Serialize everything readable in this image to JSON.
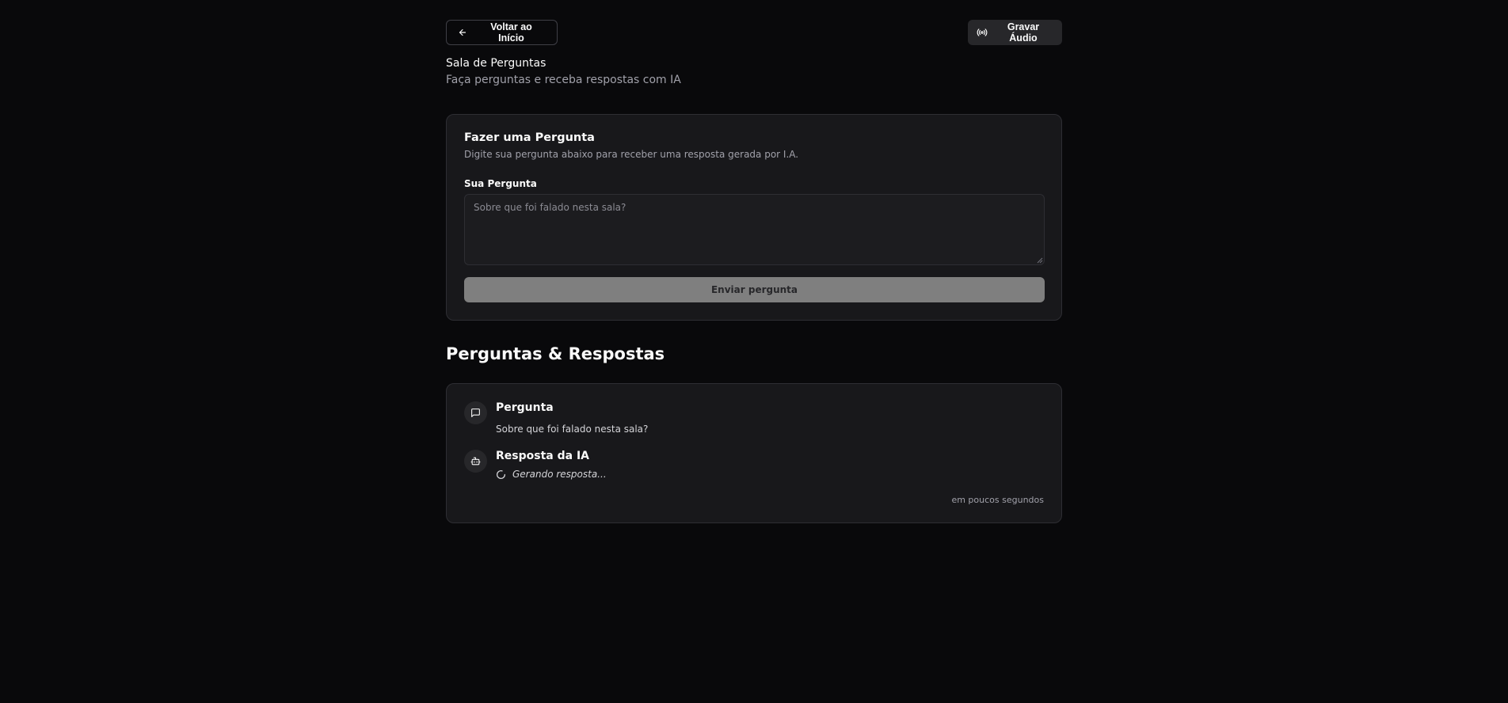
{
  "header": {
    "back_label": "Voltar ao Início",
    "record_label": "Gravar Áudio",
    "room_title": "Sala de Perguntas",
    "room_subtitle": "Faça perguntas e receba respostas com IA"
  },
  "ask_form": {
    "title": "Fazer uma Pergunta",
    "description": "Digite sua pergunta abaixo para receber uma resposta gerada por I.A.",
    "field_label": "Sua Pergunta",
    "placeholder": "Sobre que foi falado nesta sala?",
    "value": "",
    "submit_label": "Enviar pergunta"
  },
  "qa_section": {
    "title": "Perguntas & Respostas",
    "items": [
      {
        "question_label": "Pergunta",
        "question_text": "Sobre que foi falado nesta sala?",
        "answer_label": "Resposta da IA",
        "answer_status": "Gerando resposta...",
        "timestamp": "em poucos segundos"
      }
    ]
  },
  "icons": {
    "back": "arrow-left-icon",
    "record": "radio-icon",
    "question": "message-square-icon",
    "answer": "bot-icon",
    "loading": "loader-icon"
  },
  "colors": {
    "background": "#09090b",
    "card": "#18181b",
    "border": "#2e2e33",
    "muted_text": "#a1a1aa",
    "disabled_button": "#7f7f7f"
  }
}
